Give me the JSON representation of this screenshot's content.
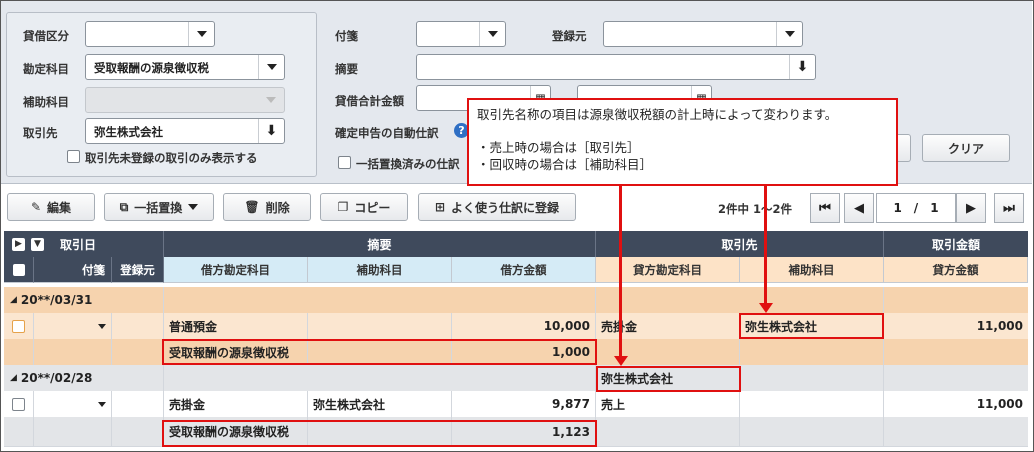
{
  "filters": {
    "taishaku_kubun": {
      "label": "貸借区分",
      "value": ""
    },
    "kanjo_kamoku": {
      "label": "勘定科目",
      "value": "受取報酬の源泉徴収税"
    },
    "hojo_kamoku": {
      "label": "補助科目",
      "value": ""
    },
    "torihikisaki": {
      "label": "取引先",
      "value": "弥生株式会社"
    },
    "only_unregistered": {
      "label": "取引先未登録の取引のみ表示する",
      "checked": false
    },
    "fusen": {
      "label": "付箋",
      "value": ""
    },
    "torokumoto": {
      "label": "登録元",
      "value": ""
    },
    "tekiyo": {
      "label": "摘要",
      "value": ""
    },
    "kingaku": {
      "label": "貸借合計金額",
      "range_sep": "~"
    },
    "kakutei": {
      "label": "確定申告の自動仕訳"
    },
    "ikkatsu": {
      "label": "一括置換済みの仕訳"
    },
    "clear_button": "クリア"
  },
  "toolbar": {
    "edit": "編集",
    "bulk_replace": "一括置換",
    "delete": "削除",
    "copy": "コピー",
    "favorite": "よく使う仕訳に登録",
    "pager_info": "2件中 1～2件",
    "page": "1",
    "page_sep": "/",
    "total_pages": "1"
  },
  "grid": {
    "header_top": {
      "date": "取引日",
      "tekiyo": "摘要",
      "torihikisaki": "取引先",
      "kingaku": "取引金額"
    },
    "header_sub": {
      "fusen": "付箋",
      "torokumoto": "登録元",
      "kari_kamoku": "借方勘定科目",
      "kari_hojo": "補助科目",
      "kari_kingaku": "借方金額",
      "kashi_kamoku": "貸方勘定科目",
      "kashi_hojo": "補助科目",
      "kashi_kingaku": "貸方金額"
    },
    "groups": [
      {
        "date": "20**/03/31",
        "rows": [
          {
            "kari_kamoku": "普通預金",
            "kari_hojo": "",
            "kari_kingaku": "10,000",
            "kashi_kamoku": "売掛金",
            "kashi_hojo": "弥生株式会社",
            "kashi_kingaku": "11,000"
          },
          {
            "kari_kamoku": "受取報酬の源泉徴収税",
            "kari_hojo": "",
            "kari_kingaku": "1,000",
            "kashi_kamoku": "",
            "kashi_hojo": "",
            "kashi_kingaku": ""
          }
        ]
      },
      {
        "date": "20**/02/28",
        "torihikisaki": "弥生株式会社",
        "rows": [
          {
            "kari_kamoku": "売掛金",
            "kari_hojo": "弥生株式会社",
            "kari_kingaku": "9,877",
            "kashi_kamoku": "売上",
            "kashi_hojo": "",
            "kashi_kingaku": "11,000"
          },
          {
            "kari_kamoku": "受取報酬の源泉徴収税",
            "kari_hojo": "",
            "kari_kingaku": "1,123",
            "kashi_kamoku": "",
            "kashi_hojo": "",
            "kashi_kingaku": ""
          }
        ]
      }
    ]
  },
  "callout": {
    "line1": "取引先名称の項目は源泉徴収税額の計上時によって変わります。",
    "line2": "・売上時の場合は［取引先］",
    "line3": "・回収時の場合は［補助科目］"
  },
  "colors": {
    "accent_red": "#e01010",
    "header_dark": "#3f4a5c",
    "group_orange": "#f6d3ae",
    "sub_blue": "#d5ebf6",
    "sub_orange": "#fde3c7"
  }
}
